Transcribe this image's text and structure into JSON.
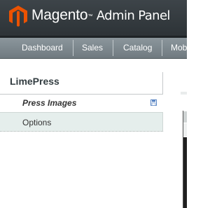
{
  "header": {
    "brand_name": "Magento",
    "brand_tm": "™",
    "brand_subtitle": "Admin Panel",
    "logo_icon": "magento-logo-icon",
    "background": "#363c40"
  },
  "nav": {
    "items": [
      "Dashboard",
      "Sales",
      "Catalog",
      "Mob"
    ]
  },
  "sidebar": {
    "title": "LimePress",
    "tabs": [
      {
        "label": "Press Images",
        "active": true,
        "icon": "save-icon"
      },
      {
        "label": "Options",
        "active": false
      }
    ]
  },
  "colors": {
    "accent": "#eb5202",
    "nav_bg": "#7f8a90",
    "tab_inactive_bg": "#e5eeec",
    "save_icon": "#5a86c4"
  }
}
